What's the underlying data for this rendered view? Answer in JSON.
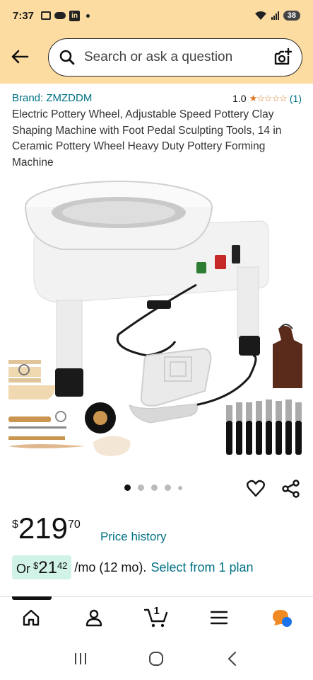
{
  "status_bar": {
    "time": "7:37",
    "linkedin_label": "in",
    "battery": "38"
  },
  "search": {
    "placeholder": "Search or ask a question"
  },
  "product": {
    "brand": "Brand: ZMZDDM",
    "rating": "1.0",
    "rating_value": 1,
    "rating_max": 5,
    "rating_count": "(1)",
    "title": "Electric Pottery Wheel, Adjustable Speed Pottery Clay Shaping Machine with Foot Pedal Sculpting Tools, 14 in Ceramic Pottery Wheel Heavy Duty Pottery Forming Machine"
  },
  "carousel": {
    "active_index": 0,
    "dot_count": 5
  },
  "price": {
    "symbol": "$",
    "whole": "219",
    "fraction": "70",
    "history_link": "Price history"
  },
  "plan": {
    "prefix": "Or",
    "symbol": "$",
    "whole": "21",
    "fraction": "42",
    "term": "/mo (12 mo).",
    "link": "Select from 1 plan"
  },
  "bottom_nav": {
    "cart_count": "1"
  },
  "colors": {
    "header_bg": "#fddca2",
    "link": "#007185",
    "star": "#de7921",
    "plan_bg": "#d1f2e6"
  }
}
